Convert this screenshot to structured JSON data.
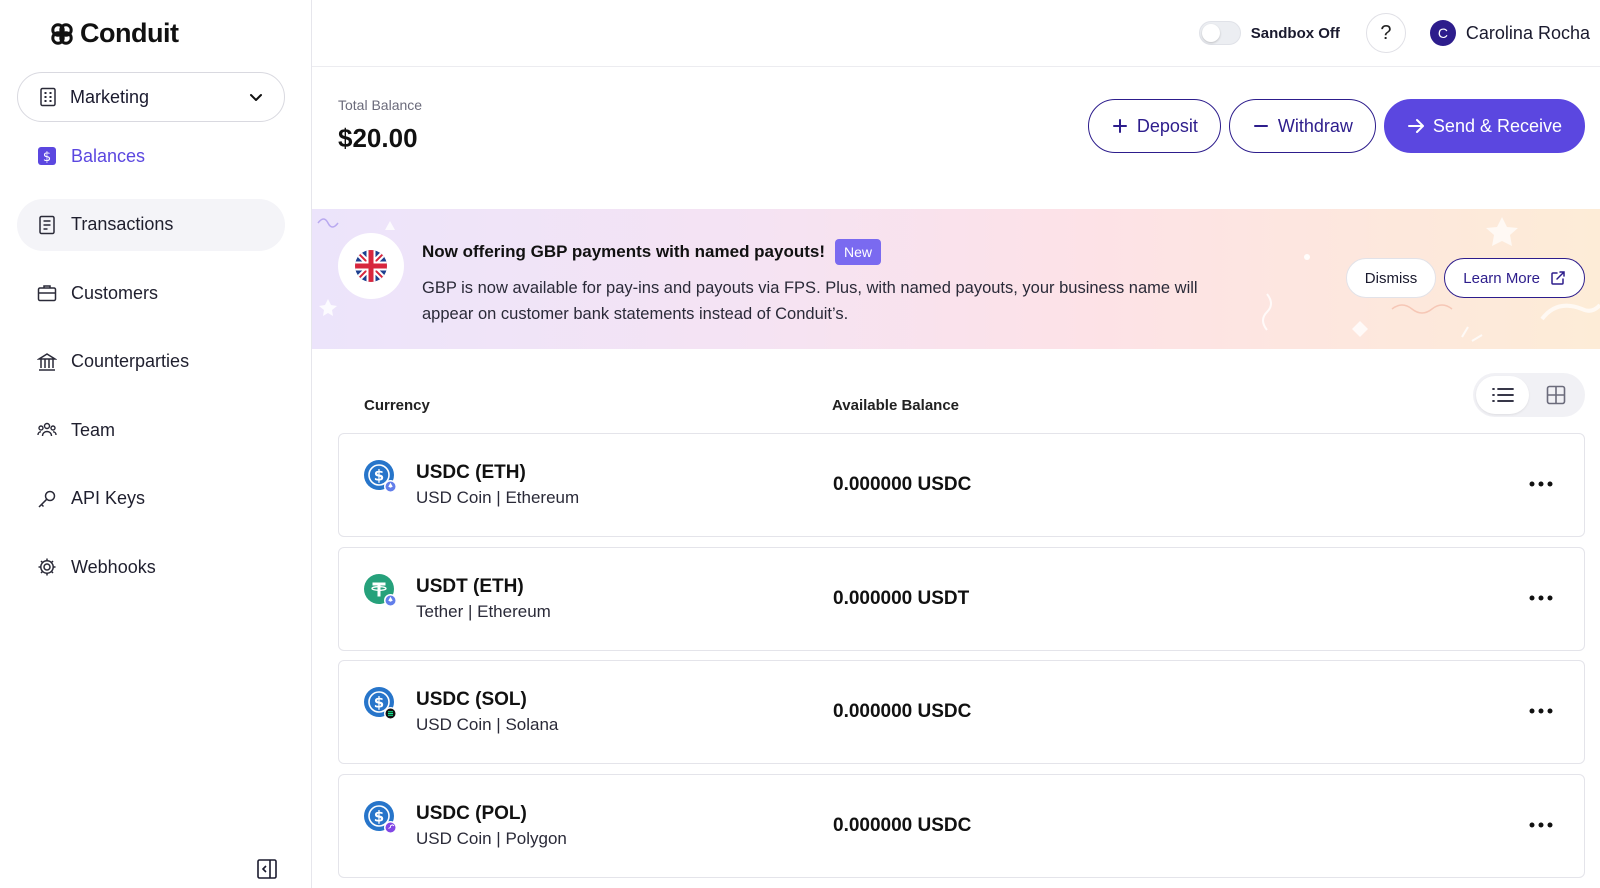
{
  "brand": {
    "name": "Conduit"
  },
  "workspace": {
    "label": "Marketing"
  },
  "sidebar": {
    "items": [
      {
        "label": "Balances",
        "icon": "dollar-square-icon",
        "active": true
      },
      {
        "label": "Transactions",
        "icon": "receipt-icon"
      },
      {
        "label": "Customers",
        "icon": "briefcase-icon"
      },
      {
        "label": "Counterparties",
        "icon": "bank-icon"
      },
      {
        "label": "Team",
        "icon": "team-icon"
      },
      {
        "label": "API Keys",
        "icon": "key-icon"
      },
      {
        "label": "Webhooks",
        "icon": "gear-icon"
      }
    ]
  },
  "topbar": {
    "sandbox_label": "Sandbox Off",
    "help_label": "?",
    "user": {
      "initial": "C",
      "name": "Carolina Rocha"
    }
  },
  "balance": {
    "label": "Total Balance",
    "value": "$20.00"
  },
  "actions": {
    "deposit": "Deposit",
    "withdraw": "Withdraw",
    "send_receive": "Send & Receive"
  },
  "banner": {
    "title": "Now offering GBP payments with named payouts!",
    "badge": "New",
    "body": "GBP is now available for pay-ins and payouts via FPS. Plus, with named payouts, your business name will appear on customer bank statements instead of Conduit’s.",
    "dismiss": "Dismiss",
    "learn_more": "Learn More"
  },
  "table": {
    "headers": {
      "currency": "Currency",
      "balance": "Available Balance"
    },
    "rows": [
      {
        "name": "USDC (ETH)",
        "sub": "USD Coin | Ethereum",
        "balance": "0.000000 USDC",
        "icon": "usdc-icon",
        "chain_icon": "ethereum-icon"
      },
      {
        "name": "USDT (ETH)",
        "sub": "Tether | Ethereum",
        "balance": "0.000000 USDT",
        "icon": "tether-icon",
        "chain_icon": "ethereum-icon"
      },
      {
        "name": "USDC (SOL)",
        "sub": "USD Coin | Solana",
        "balance": "0.000000 USDC",
        "icon": "usdc-icon",
        "chain_icon": "solana-icon"
      },
      {
        "name": "USDC (POL)",
        "sub": "USD Coin | Polygon",
        "balance": "0.000000 USDC",
        "icon": "usdc-icon",
        "chain_icon": "polygon-icon"
      }
    ]
  },
  "colors": {
    "accent": "#5b47e0",
    "navy": "#2d1d8c",
    "usdc": "#2775ca",
    "tether": "#26a17b"
  }
}
